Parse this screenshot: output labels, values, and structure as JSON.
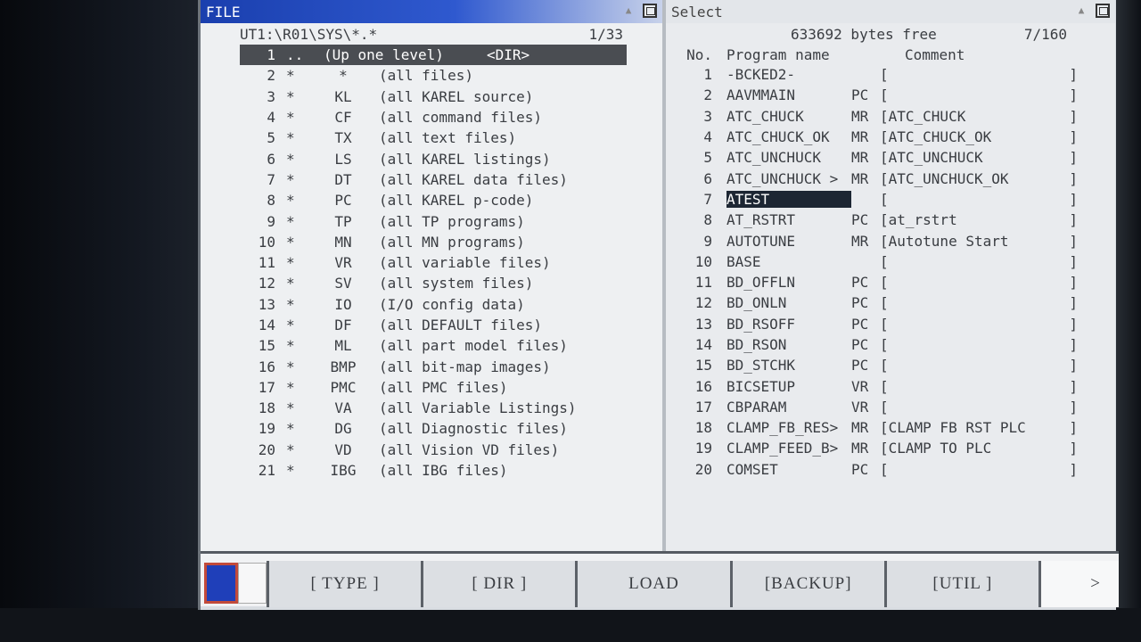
{
  "left_pane": {
    "title": "FILE",
    "path": "UT1:\\R01\\SYS\\*.*",
    "position": "1/33",
    "rows": [
      {
        "no": "1",
        "star": "..",
        "ext": "",
        "desc": "(Up one level)     <DIR>"
      },
      {
        "no": "2",
        "star": "*",
        "ext": "*",
        "desc": "(all files)"
      },
      {
        "no": "3",
        "star": "*",
        "ext": "KL",
        "desc": "(all KAREL source)"
      },
      {
        "no": "4",
        "star": "*",
        "ext": "CF",
        "desc": "(all command files)"
      },
      {
        "no": "5",
        "star": "*",
        "ext": "TX",
        "desc": "(all text files)"
      },
      {
        "no": "6",
        "star": "*",
        "ext": "LS",
        "desc": "(all KAREL listings)"
      },
      {
        "no": "7",
        "star": "*",
        "ext": "DT",
        "desc": "(all KAREL data files)"
      },
      {
        "no": "8",
        "star": "*",
        "ext": "PC",
        "desc": "(all KAREL p-code)"
      },
      {
        "no": "9",
        "star": "*",
        "ext": "TP",
        "desc": "(all TP programs)"
      },
      {
        "no": "10",
        "star": "*",
        "ext": "MN",
        "desc": "(all MN programs)"
      },
      {
        "no": "11",
        "star": "*",
        "ext": "VR",
        "desc": "(all variable files)"
      },
      {
        "no": "12",
        "star": "*",
        "ext": "SV",
        "desc": "(all system files)"
      },
      {
        "no": "13",
        "star": "*",
        "ext": "IO",
        "desc": "(I/O config data)"
      },
      {
        "no": "14",
        "star": "*",
        "ext": "DF",
        "desc": "(all DEFAULT files)"
      },
      {
        "no": "15",
        "star": "*",
        "ext": "ML",
        "desc": "(all part model files)"
      },
      {
        "no": "16",
        "star": "*",
        "ext": "BMP",
        "desc": "(all bit-map images)"
      },
      {
        "no": "17",
        "star": "*",
        "ext": "PMC",
        "desc": "(all PMC files)"
      },
      {
        "no": "18",
        "star": "*",
        "ext": "VA",
        "desc": "(all Variable Listings)"
      },
      {
        "no": "19",
        "star": "*",
        "ext": "DG",
        "desc": "(all Diagnostic files)"
      },
      {
        "no": "20",
        "star": "*",
        "ext": "VD",
        "desc": "(all Vision VD files)"
      },
      {
        "no": "21",
        "star": "*",
        "ext": "IBG",
        "desc": "(all IBG files)"
      }
    ]
  },
  "right_pane": {
    "title": "Select",
    "free_space": "633692 bytes free",
    "position": "7/160",
    "headers": {
      "no": "No.",
      "name": "Program name",
      "comment": "Comment"
    },
    "rows": [
      {
        "no": "1",
        "name": "-BCKED2-",
        "type": "",
        "comment": ""
      },
      {
        "no": "2",
        "name": "AAVMMAIN",
        "type": "PC",
        "comment": ""
      },
      {
        "no": "3",
        "name": "ATC_CHUCK",
        "type": "MR",
        "comment": "ATC_CHUCK"
      },
      {
        "no": "4",
        "name": "ATC_CHUCK_OK",
        "type": "MR",
        "comment": "ATC_CHUCK_OK"
      },
      {
        "no": "5",
        "name": "ATC_UNCHUCK",
        "type": "MR",
        "comment": "ATC_UNCHUCK"
      },
      {
        "no": "6",
        "name": "ATC_UNCHUCK >",
        "type": "MR",
        "comment": "ATC_UNCHUCK_OK"
      },
      {
        "no": "7",
        "name": "ATEST",
        "type": "",
        "comment": ""
      },
      {
        "no": "8",
        "name": "AT_RSTRT",
        "type": "PC",
        "comment": "at_rstrt"
      },
      {
        "no": "9",
        "name": "AUTOTUNE",
        "type": "MR",
        "comment": "Autotune Start"
      },
      {
        "no": "10",
        "name": "BASE",
        "type": "",
        "comment": ""
      },
      {
        "no": "11",
        "name": "BD_OFFLN",
        "type": "PC",
        "comment": ""
      },
      {
        "no": "12",
        "name": "BD_ONLN",
        "type": "PC",
        "comment": ""
      },
      {
        "no": "13",
        "name": "BD_RSOFF",
        "type": "PC",
        "comment": ""
      },
      {
        "no": "14",
        "name": "BD_RSON",
        "type": "PC",
        "comment": ""
      },
      {
        "no": "15",
        "name": "BD_STCHK",
        "type": "PC",
        "comment": ""
      },
      {
        "no": "16",
        "name": "BICSETUP",
        "type": "VR",
        "comment": ""
      },
      {
        "no": "17",
        "name": "CBPARAM",
        "type": "VR",
        "comment": ""
      },
      {
        "no": "18",
        "name": "CLAMP_FB_RES>",
        "type": "MR",
        "comment": "CLAMP FB RST PLC"
      },
      {
        "no": "19",
        "name": "CLAMP_FEED_B>",
        "type": "MR",
        "comment": "CLAMP TO PLC"
      },
      {
        "no": "20",
        "name": "COMSET",
        "type": "PC",
        "comment": ""
      }
    ]
  },
  "function_keys": {
    "type": "[ TYPE ]",
    "dir": "[ DIR ]",
    "load": "LOAD",
    "backup": "[BACKUP]",
    "util": "[UTIL ]",
    "next": ">"
  },
  "colors": {
    "title_active": "#1a3fae",
    "selection": "#4a4d52",
    "indicator": "#1f3fb9"
  },
  "icons": [
    "scroll-up-icon",
    "maximize-icon"
  ]
}
